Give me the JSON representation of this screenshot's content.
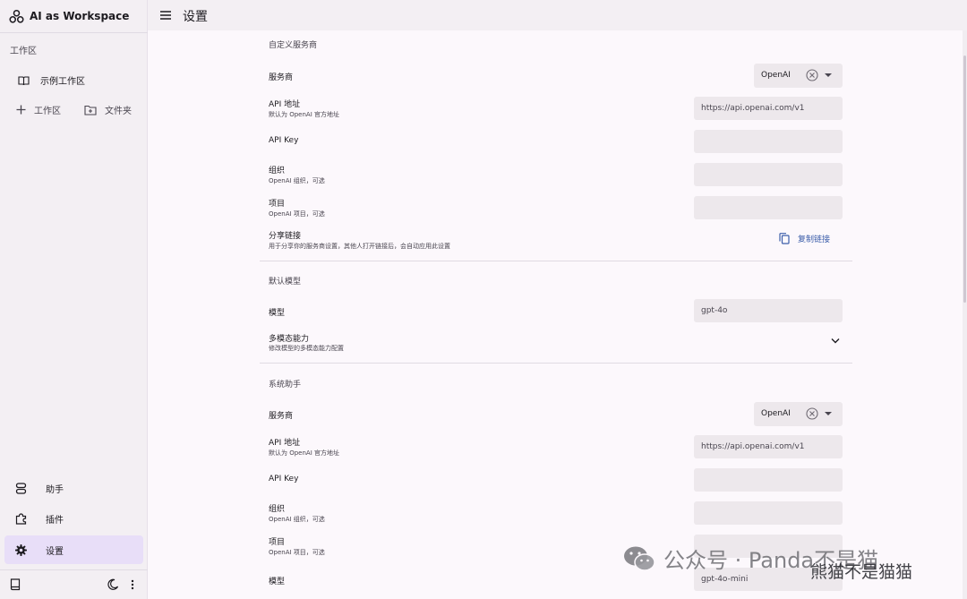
{
  "app": {
    "title": "AI as Workspace"
  },
  "header": {
    "title": "设置"
  },
  "sidebar": {
    "section_label": "工作区",
    "workspace_item": "示例工作区",
    "add_workspace": "工作区",
    "add_folder": "文件夹",
    "nav": [
      {
        "label": "助手",
        "icon": "assistant-icon"
      },
      {
        "label": "插件",
        "icon": "puzzle-icon"
      },
      {
        "label": "设置",
        "icon": "gear-icon",
        "active": true
      }
    ],
    "footer_icons": [
      "book-icon",
      "moon-icon",
      "more-vert-icon"
    ]
  },
  "settings": {
    "custom_provider": {
      "title": "自定义服务商",
      "provider": {
        "label": "服务商",
        "value": "OpenAI"
      },
      "api_base": {
        "label": "API 地址",
        "desc": "默认为 OpenAI 官方地址",
        "placeholder": "https://api.openai.com/v1"
      },
      "api_key": {
        "label": "API Key",
        "value": ""
      },
      "org": {
        "label": "组织",
        "desc": "OpenAI 组织，可选",
        "value": ""
      },
      "project": {
        "label": "项目",
        "desc": "OpenAI 项目，可选",
        "value": ""
      },
      "share": {
        "label": "分享链接",
        "desc": "用于分享你的服务商设置，其他人打开链接后，会自动应用此设置",
        "button": "复制链接"
      }
    },
    "default_model": {
      "title": "默认模型",
      "model": {
        "label": "模型",
        "value": "gpt-4o"
      },
      "multimodal": {
        "label": "多模态能力",
        "desc": "修改模型的多模态能力配置"
      }
    },
    "system_assistant": {
      "title": "系统助手",
      "provider": {
        "label": "服务商",
        "value": "OpenAI"
      },
      "api_base": {
        "label": "API 地址",
        "desc": "默认为 OpenAI 官方地址",
        "placeholder": "https://api.openai.com/v1"
      },
      "api_key": {
        "label": "API Key",
        "value": ""
      },
      "org": {
        "label": "组织",
        "desc": "OpenAI 组织，可选",
        "value": ""
      },
      "project": {
        "label": "项目",
        "desc": "OpenAI 项目，可选",
        "value": ""
      },
      "model": {
        "label": "模型",
        "value": "gpt-4o-mini"
      }
    }
  },
  "watermark": {
    "text": "公众号 · Panda不是猫",
    "sub": "熊猫不是猫猫"
  }
}
